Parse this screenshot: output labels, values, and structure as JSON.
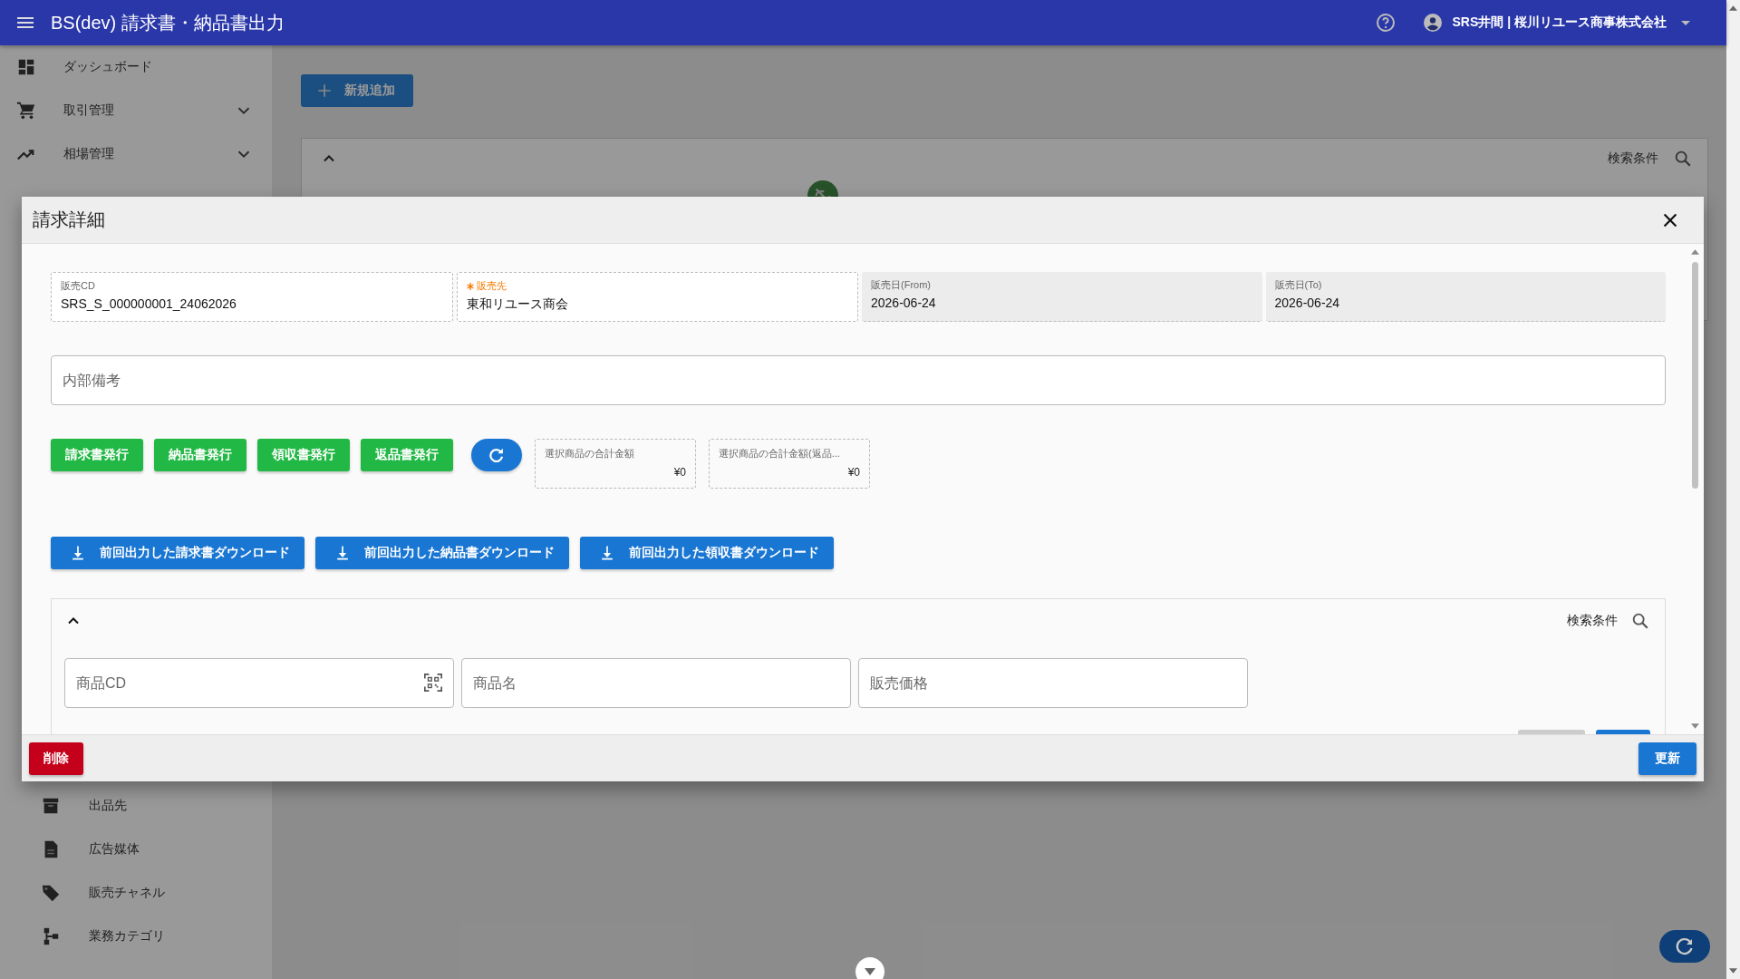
{
  "app_bar": {
    "title": "BS(dev) 請求書・納品書出力",
    "user": "SRS井間 | 桜川リユース商事株式会社"
  },
  "sidebar": {
    "items": [
      {
        "label": "ダッシュボード",
        "kind": "link"
      },
      {
        "label": "取引管理",
        "kind": "group",
        "expanded": false
      },
      {
        "label": "相場管理",
        "kind": "group",
        "expanded": false
      }
    ],
    "sub_items": [
      {
        "label": "出品先"
      },
      {
        "label": "広告媒体"
      },
      {
        "label": "販売チャネル"
      },
      {
        "label": "業務カテゴリ"
      }
    ]
  },
  "page": {
    "add_button": "新規追加",
    "search_panel": {
      "title": "検索条件",
      "expanded": true
    }
  },
  "dialog": {
    "title": "請求詳細",
    "fields": [
      {
        "label": "販売CD",
        "value": "SRS_S_000000001_24062026",
        "required": false,
        "disabled": false
      },
      {
        "label": "販売先",
        "value": "東和リユース商会",
        "required": true,
        "disabled": false
      },
      {
        "label": "販売日(From)",
        "value": "2026-06-24",
        "required": false,
        "disabled": true
      },
      {
        "label": "販売日(To)",
        "value": "2026-06-24",
        "required": false,
        "disabled": true
      }
    ],
    "memo": {
      "placeholder": "内部備考"
    },
    "issue_buttons": [
      "請求書発行",
      "納品書発行",
      "領収書発行",
      "返品書発行"
    ],
    "totals": [
      {
        "label": "選択商品の合計金額",
        "value": "¥0"
      },
      {
        "label": "選択商品の合計金額(返品...",
        "value": "¥0"
      }
    ],
    "download_buttons": [
      "前回出力した請求書ダウンロード",
      "前回出力した納品書ダウンロード",
      "前回出力した領収書ダウンロード"
    ],
    "filter": {
      "title": "検索条件",
      "expanded": true,
      "fields": [
        {
          "placeholder": "商品CD",
          "kind": "scan"
        },
        {
          "placeholder": "商品名",
          "kind": "text"
        },
        {
          "placeholder": "販売価格",
          "kind": "text"
        }
      ]
    },
    "delete_button": "削除",
    "update_button": "更新"
  }
}
